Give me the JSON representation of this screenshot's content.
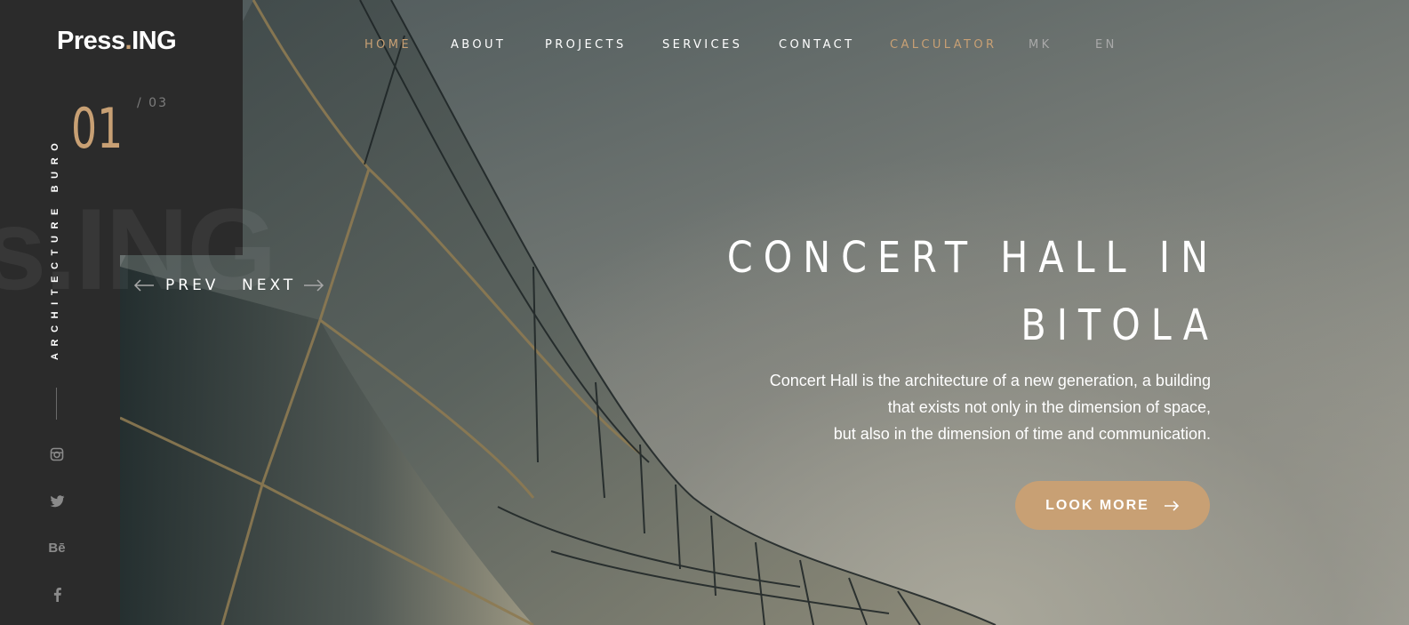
{
  "brand": {
    "name_part1": "Press",
    "dot": ".",
    "name_part2": "ING",
    "accent_color": "#c8a074"
  },
  "nav": {
    "items": [
      {
        "label": "HOME",
        "active": true
      },
      {
        "label": "ABOUT"
      },
      {
        "label": "PROJECTS"
      },
      {
        "label": "SERVICES"
      },
      {
        "label": "CONTACT"
      },
      {
        "label": "CALCULATOR",
        "highlight": true
      }
    ],
    "languages": [
      "MK",
      "EN"
    ]
  },
  "sidebar": {
    "tagline": "ARCHITECTURE BURO",
    "watermark": "s.ING",
    "slide_current": "01",
    "slide_total": "/ 03",
    "social_icons": [
      "instagram-icon",
      "twitter-icon",
      "behance-icon",
      "facebook-icon"
    ],
    "behance_glyph": "Bē"
  },
  "pager": {
    "prev": "PREV",
    "next": "NEXT"
  },
  "hero": {
    "title_line1": "CONCERT HALL IN",
    "title_line2": "BITOLA",
    "desc_line1": "Concert Hall is the architecture of a new generation, a building",
    "desc_line2": "that exists not only in the dimension of space,",
    "desc_line3": "but also in the dimension of time and communication.",
    "cta_label": "LOOK MORE"
  }
}
